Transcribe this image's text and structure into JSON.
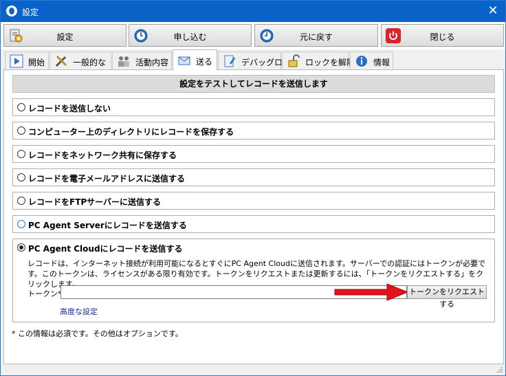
{
  "window": {
    "title": "設定",
    "close_glyph": "✕"
  },
  "toolbar": {
    "buttons": [
      {
        "label": "設定",
        "icon": "settings-doc-icon"
      },
      {
        "label": "申し込む",
        "icon": "apply-clock-icon"
      },
      {
        "label": "元に戻す",
        "icon": "revert-clock-icon"
      },
      {
        "label": "閉じる",
        "icon": "power-icon",
        "accent": "#d8232a"
      }
    ]
  },
  "tabs": [
    {
      "label": "開始",
      "icon": "play-icon",
      "active": false
    },
    {
      "label": "一般的な",
      "icon": "tools-icon",
      "active": false
    },
    {
      "label": "活動内容",
      "icon": "activity-icon",
      "active": false
    },
    {
      "label": "送る",
      "icon": "send-mail-icon",
      "active": true
    },
    {
      "label": "デバッグログ",
      "icon": "debug-log-icon",
      "active": false
    },
    {
      "label": "ロックを解除",
      "icon": "unlock-icon",
      "active": false
    },
    {
      "label": "情報",
      "icon": "info-icon",
      "active": false
    }
  ],
  "send": {
    "header": "設定をテストしてレコードを送信します",
    "options": [
      {
        "label": "レコードを送信しない",
        "selected": false
      },
      {
        "label": "コンピューター上のディレクトリにレコードを保存する",
        "selected": false
      },
      {
        "label": "レコードをネットワーク共有に保存する",
        "selected": false
      },
      {
        "label": "レコードを電子メールアドレスに送信する",
        "selected": false
      },
      {
        "label": "レコードをFTPサーバーに送信する",
        "selected": false
      },
      {
        "label": "PC Agent Serverにレコードを送信する",
        "selected": false
      }
    ],
    "cloud": {
      "label": "PC Agent Cloudにレコードを送信する",
      "selected": true,
      "description": "レコードは、インターネット接続が利用可能になるとすぐにPC Agent Cloudに送信されます。サーバーでの認証にはトークンが必要です。このトークンは、ライセンスがある限り有効です。トークンをリクエストまたは更新するには、「トークンをリクエストする」をクリックします。",
      "token_label": "トークン*:",
      "token_value": "",
      "request_button": "トークンをリクエストする",
      "advanced_link": "高度な設定"
    },
    "footnote": "* この情報は必須です。その他はオプションです。"
  },
  "colors": {
    "titlebar": "#0a63c9",
    "arrow": "#e0141b",
    "link": "#1a2a9a"
  }
}
